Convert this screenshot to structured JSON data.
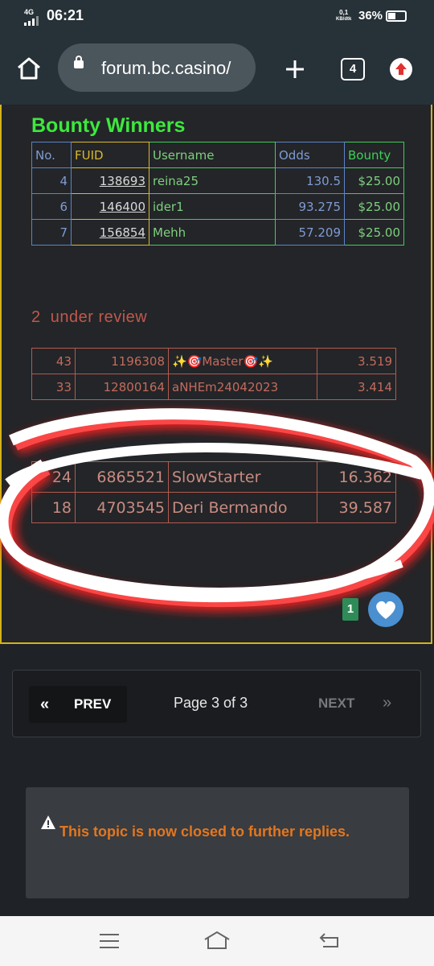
{
  "status_bar": {
    "network": "4G",
    "time": "06:21",
    "speed_value": "0,1",
    "speed_unit": "KB/dtk",
    "battery": "36%"
  },
  "browser": {
    "url": "forum.bc.casino/",
    "tab_count": "4"
  },
  "bounty": {
    "title": "Bounty Winners",
    "headers": [
      "No.",
      "FUID",
      "Username",
      "Odds",
      "Bounty"
    ],
    "rows": [
      [
        "4",
        "138693",
        "reina25",
        "130.5",
        "$25.00"
      ],
      [
        "6",
        "146400",
        "ider1",
        "93.275",
        "$25.00"
      ],
      [
        "7",
        "156854",
        "Mehh",
        "57.209",
        "$25.00"
      ]
    ]
  },
  "review": {
    "title": "2  under review",
    "rows": [
      [
        "43",
        "1196308",
        "✨🎯Master🎯✨",
        "3.519"
      ],
      [
        "33",
        "12800164",
        "aNHEm24042023",
        "3.414"
      ]
    ]
  },
  "highlight": {
    "rows": [
      [
        "24",
        "6865521",
        "SlowStarter",
        "16.362"
      ],
      [
        "18",
        "4703545",
        "Deri Bermando",
        "39.587"
      ]
    ]
  },
  "post": {
    "like_count": "1"
  },
  "pager": {
    "prev": "PREV",
    "page": "Page 3 of 3",
    "next": "NEXT",
    "prev_icon": "«",
    "next_icon": "»"
  },
  "closed_notice": "This topic is now closed to further replies.",
  "colors": {
    "title_green": "#3ee83e",
    "review_red": "#c0584c",
    "notice_orange": "#e3771f",
    "border_gold": "#d4b21c"
  }
}
